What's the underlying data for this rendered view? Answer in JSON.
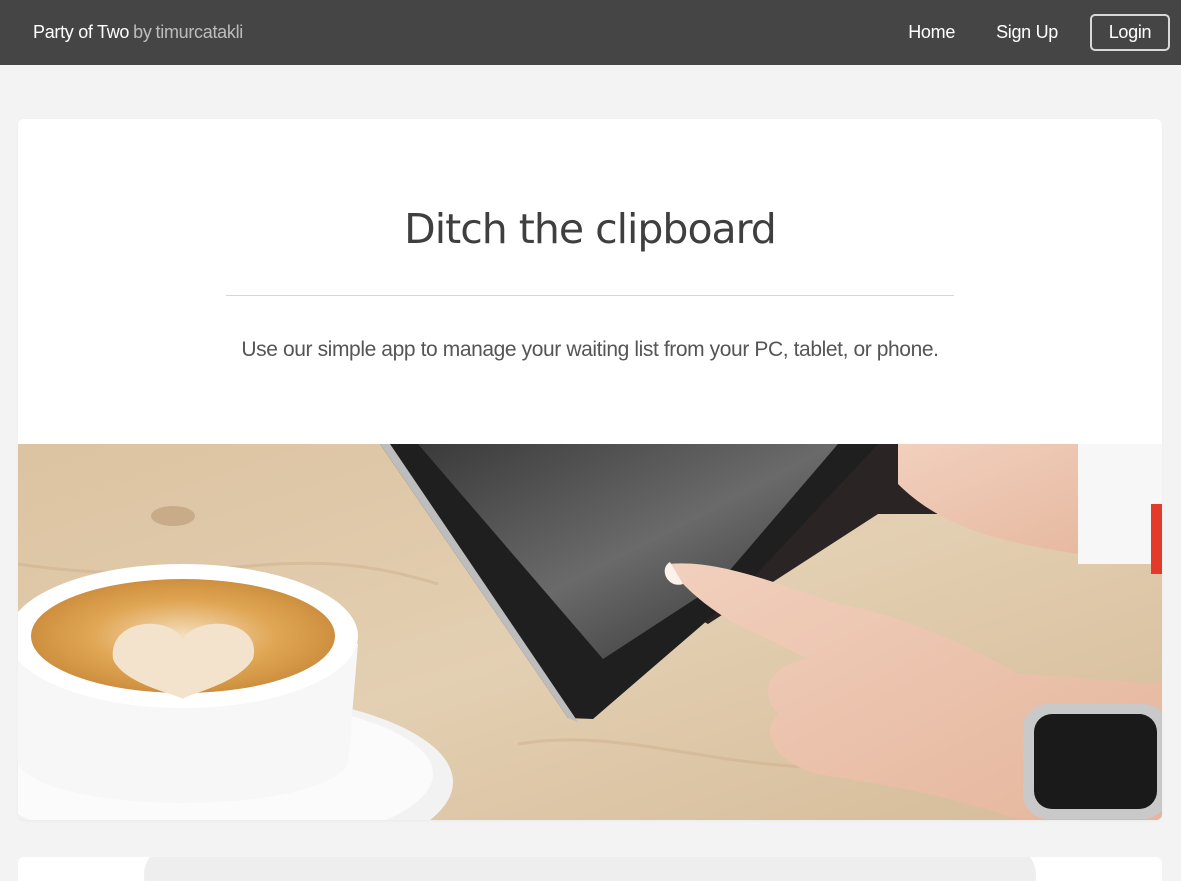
{
  "navbar": {
    "brand_name": "Party of Two",
    "brand_sep": "by",
    "brand_author": "timurcatakli",
    "links": {
      "home": "Home",
      "signup": "Sign Up",
      "login": "Login"
    }
  },
  "hero": {
    "title": "Ditch the clipboard",
    "subtitle": "Use our simple app to manage your waiting list from your PC, tablet, or phone."
  },
  "colors": {
    "navbar_bg": "#454545",
    "page_bg": "#f3f3f3",
    "card_bg": "#ffffff"
  }
}
